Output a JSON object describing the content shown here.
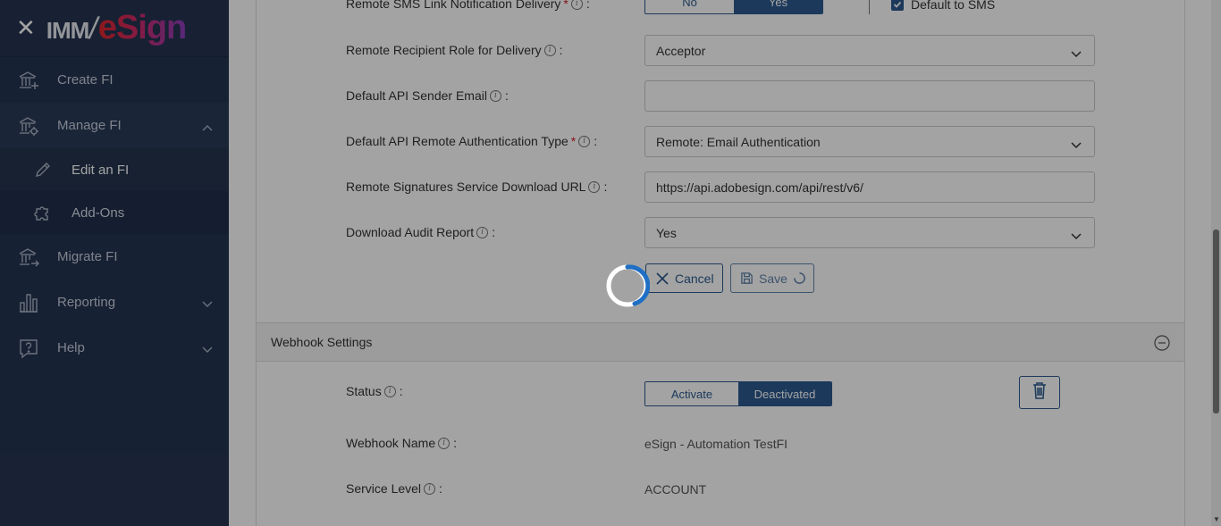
{
  "sidebar": {
    "brand": {
      "imm": "IMM",
      "slash": "/",
      "esign": "eSign"
    },
    "items": [
      {
        "label": "Create FI",
        "icon": "bank-plus-icon"
      },
      {
        "label": "Manage FI",
        "icon": "bank-gear-icon",
        "expanded": true
      },
      {
        "label": "Migrate FI",
        "icon": "bank-arrow-icon"
      },
      {
        "label": "Reporting",
        "icon": "bar-chart-icon"
      },
      {
        "label": "Help",
        "icon": "help-bubble-icon"
      }
    ],
    "sub_items": [
      {
        "label": "Edit an FI",
        "icon": "pencil-icon",
        "active": true
      },
      {
        "label": "Add-Ons",
        "icon": "puzzle-icon"
      }
    ]
  },
  "form": {
    "sms_delivery": {
      "label": "Remote SMS Link Notification Delivery",
      "no": "No",
      "yes": "Yes",
      "checkbox_label": "Default to SMS"
    },
    "recipient_role": {
      "label": "Remote Recipient Role for Delivery",
      "value": "Acceptor"
    },
    "sender_email": {
      "label": "Default API Sender Email",
      "value": ""
    },
    "auth_type": {
      "label": "Default API Remote Authentication Type",
      "value": "Remote: Email Authentication"
    },
    "download_url": {
      "label": "Remote Signatures Service Download URL",
      "value": "https://api.adobesign.com/api/rest/v6/"
    },
    "audit_report": {
      "label": "Download Audit Report",
      "value": "Yes"
    },
    "cancel_label": "Cancel",
    "save_label": "Save"
  },
  "webhook": {
    "title": "Webhook Settings",
    "status": {
      "label": "Status",
      "activate": "Activate",
      "deactivated": "Deactivated"
    },
    "name": {
      "label": "Webhook Name",
      "value": "eSign - Automation TestFI"
    },
    "service_level": {
      "label": "Service Level",
      "value": "ACCOUNT"
    }
  },
  "colors": {
    "sidebar_bg": "#253552",
    "accent": "#2c5a8f",
    "required": "#d1232a",
    "spinner": "#1f6fc5"
  },
  "loading": true
}
